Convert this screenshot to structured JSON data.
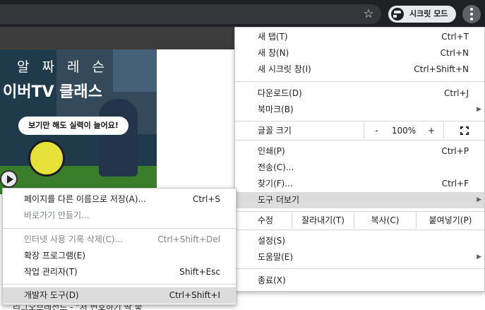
{
  "toolbar": {
    "incognito_label": "시크릿 모드",
    "icons": [
      "star-icon",
      "incognito-icon",
      "more-vert-icon"
    ]
  },
  "page": {
    "ad_top": "알 짜 레 슨",
    "ad_title": "이버TV 클래스",
    "ad_bubble": "보기만 해도 실력이 늘어요!",
    "bottom_text": "리그오브레전드 - \"저 변호하기 딱 좋"
  },
  "menu": {
    "new_tab": {
      "label": "새 탭(T)",
      "shortcut": "Ctrl+T"
    },
    "new_window": {
      "label": "새 창(N)",
      "shortcut": "Ctrl+N"
    },
    "new_incognito": {
      "label": "새 시크릿 창(I)",
      "shortcut": "Ctrl+Shift+N"
    },
    "downloads": {
      "label": "다운로드(D)",
      "shortcut": "Ctrl+J"
    },
    "bookmarks": {
      "label": "북마크(B)"
    },
    "zoom": {
      "label": "글꼴 크기",
      "minus": "-",
      "value": "100%",
      "plus": "+"
    },
    "print": {
      "label": "인쇄(P)",
      "shortcut": "Ctrl+P"
    },
    "cast": {
      "label": "전송(C)..."
    },
    "find": {
      "label": "찾기(F)...",
      "shortcut": "Ctrl+F"
    },
    "more_tools": {
      "label": "도구 더보기"
    },
    "edit": {
      "label": "수정",
      "cut": "잘라내기(T)",
      "copy": "복사(C)",
      "paste": "붙여넣기(P)"
    },
    "settings": {
      "label": "설정(S)"
    },
    "help": {
      "label": "도움말(E)"
    },
    "exit": {
      "label": "종료(X)"
    }
  },
  "submenu": {
    "save_as": {
      "label": "페이지를 다른 이름으로 저장(A)...",
      "shortcut": "Ctrl+S"
    },
    "shortcut": {
      "label": "바로가기 만들기..."
    },
    "clear_data": {
      "label": "인터넷 사용 기록 삭제(C)...",
      "shortcut": "Ctrl+Shift+Del"
    },
    "extensions": {
      "label": "확장 프로그램(E)"
    },
    "task_manager": {
      "label": "작업 관리자(T)",
      "shortcut": "Shift+Esc"
    },
    "devtools": {
      "label": "개발자 도구(D)",
      "shortcut": "Ctrl+Shift+I"
    }
  }
}
